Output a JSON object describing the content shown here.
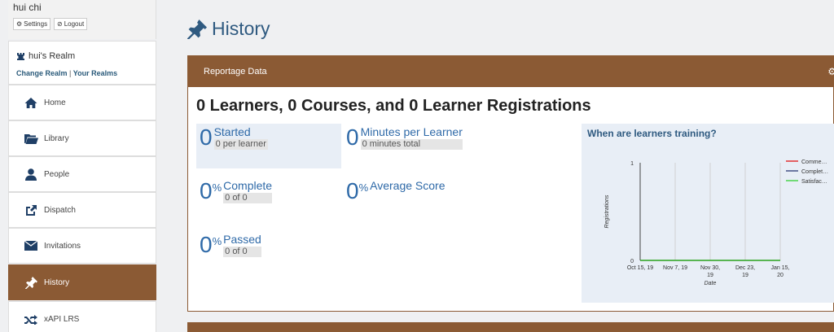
{
  "user": {
    "name": "hui chi",
    "settings_label": "Settings",
    "logout_label": "Logout"
  },
  "realm": {
    "title": "hui's Realm",
    "change_label": "Change Realm",
    "separator": "|",
    "your_label": "Your Realms"
  },
  "nav": [
    {
      "label": "Home",
      "icon": "home-icon"
    },
    {
      "label": "Library",
      "icon": "folder-icon"
    },
    {
      "label": "People",
      "icon": "person-icon"
    },
    {
      "label": "Dispatch",
      "icon": "share-icon"
    },
    {
      "label": "Invitations",
      "icon": "envelope-icon"
    },
    {
      "label": "History",
      "icon": "pushpin-icon",
      "active": true
    },
    {
      "label": "xAPI LRS",
      "icon": "shuffle-icon"
    }
  ],
  "page": {
    "title": "History"
  },
  "panel": {
    "header": "Reportage Data",
    "headline": "0 Learners, 0 Courses, and 0 Learner Registrations",
    "stats": {
      "started": {
        "value": "0",
        "label": "Started",
        "sub": "0 per learner"
      },
      "minutes": {
        "value": "0",
        "label": "Minutes per Learner",
        "sub": "0 minutes total"
      },
      "complete": {
        "value": "0",
        "pct": "%",
        "label": "Complete",
        "sub": "0 of 0"
      },
      "average": {
        "value": "0",
        "pct": "%",
        "label": "Average Score"
      },
      "passed": {
        "value": "0",
        "pct": "%",
        "label": "Passed",
        "sub": "0 of 0"
      }
    }
  },
  "chart_data": {
    "type": "line",
    "title": "When are learners training?",
    "xlabel": "Date",
    "ylabel": "Registrations",
    "x": [
      "Oct 15, 19",
      "Nov 7, 19",
      "Nov 30, 19",
      "Dec 23, 19",
      "Jan 15, 20"
    ],
    "ylim": [
      0,
      1
    ],
    "yticks": [
      "1",
      "0"
    ],
    "series": [
      {
        "name": "Comme…",
        "color": "#e00000",
        "values": [
          0,
          0,
          0,
          0,
          0
        ]
      },
      {
        "name": "Complet…",
        "color": "#1a2a6a",
        "values": [
          0,
          0,
          0,
          0,
          0
        ]
      },
      {
        "name": "Satisfac…",
        "color": "#22cc22",
        "values": [
          0,
          0,
          0,
          0,
          0
        ]
      }
    ],
    "grid": true,
    "legend": "top-right"
  },
  "colors": {
    "accent": "#8b5a34",
    "link": "#2f6aa8",
    "title": "#2f5a80"
  }
}
